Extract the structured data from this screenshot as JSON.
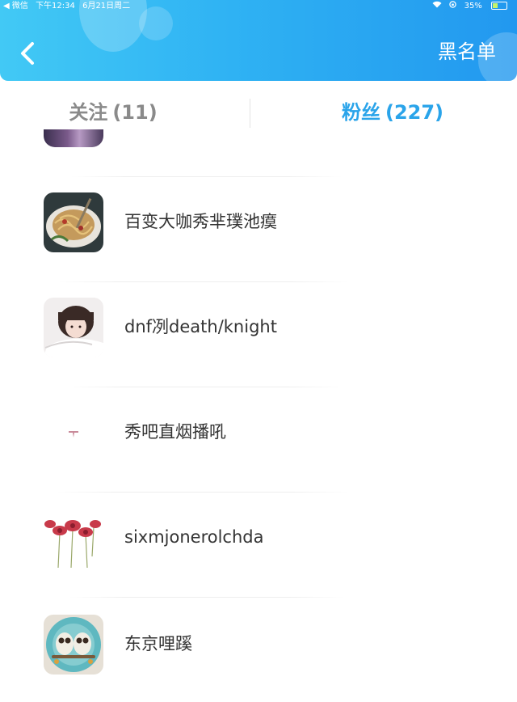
{
  "status_bar": {
    "carrier": "◀ 微信",
    "time": "下午12:34",
    "date": "6月21日周二",
    "battery": "35%",
    "battery_level": 0.35
  },
  "header": {
    "right_action": "黑名单",
    "gradient": [
      "#42c9f5",
      "#2298ef"
    ]
  },
  "tabs": [
    {
      "label": "关注",
      "count": "(11)"
    },
    {
      "label": "粉丝",
      "count": "(227)"
    }
  ],
  "active_tab_color": "#2aa4ea",
  "inactive_tab_color": "#8a8a8a",
  "fans": [
    {
      "name": "百变大咖秀芈璞池瘼",
      "avatar": "noodle-bowl-photo"
    },
    {
      "name": "dnf冽death/knight",
      "avatar": "girl-portrait-photo"
    },
    {
      "name": "秀吧直烟播吼",
      "avatar": "small-pink-mark"
    },
    {
      "name": "sixmjonerolchda",
      "avatar": "red-flowers-drawing"
    },
    {
      "name": "东京哩蹊",
      "avatar": "owl-cookies-photo"
    }
  ]
}
